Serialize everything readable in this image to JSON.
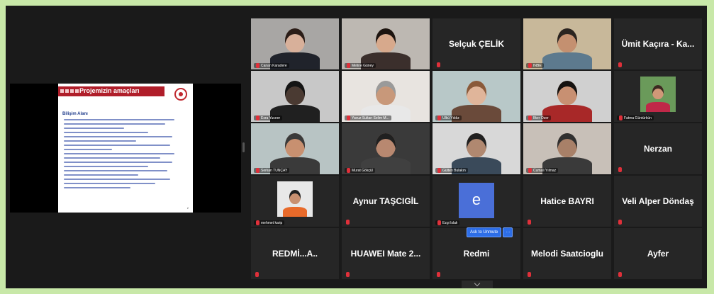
{
  "shared_screen": {
    "slide_title": "Projemizin amaçları",
    "slide_subtitle": "Bilişim Alanı"
  },
  "participants": [
    {
      "name": "Canan Karadere",
      "type": "video",
      "skin": "#d8b09a",
      "hair": "#2a1d18",
      "shirt": "#20232b",
      "bg": "#a8a6a4"
    },
    {
      "name": "Meline Güney",
      "type": "video",
      "skin": "#d7a98c",
      "hair": "#1c1410",
      "shirt": "#3b2f2c",
      "bg": "#bdb8b2"
    },
    {
      "name": "Selçuk ÇELİK",
      "type": "name"
    },
    {
      "name": "INBE",
      "type": "video",
      "skin": "#c49070",
      "hair": "#2a2420",
      "shirt": "#5d7a8e",
      "bg": "#c8b89a"
    },
    {
      "name": "Ümit Kaçıra - Ka...",
      "type": "name"
    },
    {
      "name": "Esra Yuceer",
      "type": "video",
      "skin": "#4a3a32",
      "hair": "#141414",
      "shirt": "#202020",
      "bg": "#c8c8c8"
    },
    {
      "name": "Yavuz Sultan Selim M...",
      "type": "video",
      "skin": "#c8987a",
      "hair": "#9a9a9a",
      "shirt": "#e8e8e8",
      "bg": "#e8e4e0",
      "active": true
    },
    {
      "name": "Ülkü Yıldız",
      "type": "video",
      "skin": "#e0b59a",
      "hair": "#8a5a3a",
      "shirt": "#6a4a3a",
      "bg": "#b8c8c8"
    },
    {
      "name": "İlker Özer",
      "type": "video",
      "skin": "#c89072",
      "hair": "#151210",
      "shirt": "#a82828",
      "bg": "#d0d0d0"
    },
    {
      "name": "Fatma Güntürkün",
      "type": "small",
      "skin": "#d09878",
      "hair": "#3a2a20",
      "shirt": "#c02848",
      "bg": "#6a9a5a"
    },
    {
      "name": "Serkan TUNÇAY",
      "type": "video",
      "skin": "#c89070",
      "hair": "#3a3a3a",
      "shirt": "#3a3a3a",
      "bg": "#b8c4c4"
    },
    {
      "name": "Murat Gökçül",
      "type": "video",
      "skin": "#b88870",
      "hair": "#202020",
      "shirt": "#404040",
      "bg": "#3a3a3a"
    },
    {
      "name": "Gülten Bulakın",
      "type": "video",
      "skin": "#b08870",
      "hair": "#202020",
      "shirt": "#3a4a5a",
      "bg": "#d8d8d8"
    },
    {
      "name": "Cumali Yılmaz",
      "type": "video",
      "skin": "#a88068",
      "hair": "#303030",
      "shirt": "#3a3a3a",
      "bg": "#c8c0b8"
    },
    {
      "name": "Nerzan",
      "type": "name"
    },
    {
      "name": "mehmet karip",
      "type": "small",
      "skin": "#c89070",
      "hair": "#202020",
      "shirt": "#e86a2a",
      "bg": "#e8e8e8"
    },
    {
      "name": "Aynur TAŞCIGİL",
      "type": "name"
    },
    {
      "name": "Ezgi Islak",
      "type": "avatar",
      "letter": "e"
    },
    {
      "name": "Hatice BAYRI",
      "type": "name"
    },
    {
      "name": "Veli Alper Döndaş",
      "type": "name"
    },
    {
      "name": "REDMİ...A..",
      "type": "name"
    },
    {
      "name": "HUAWEI Mate 2...",
      "type": "name"
    },
    {
      "name": "Redmi",
      "type": "name"
    },
    {
      "name": "Melodi Saatcioglu",
      "type": "name"
    },
    {
      "name": "Ayfer",
      "type": "name"
    }
  ],
  "popup": {
    "ask_unmute": "Ask to Unmute",
    "more": "···"
  },
  "colors": {
    "frame": "#c8e8a8",
    "active_speaker": "#d6d34a",
    "muted_icon": "#e0303a"
  }
}
